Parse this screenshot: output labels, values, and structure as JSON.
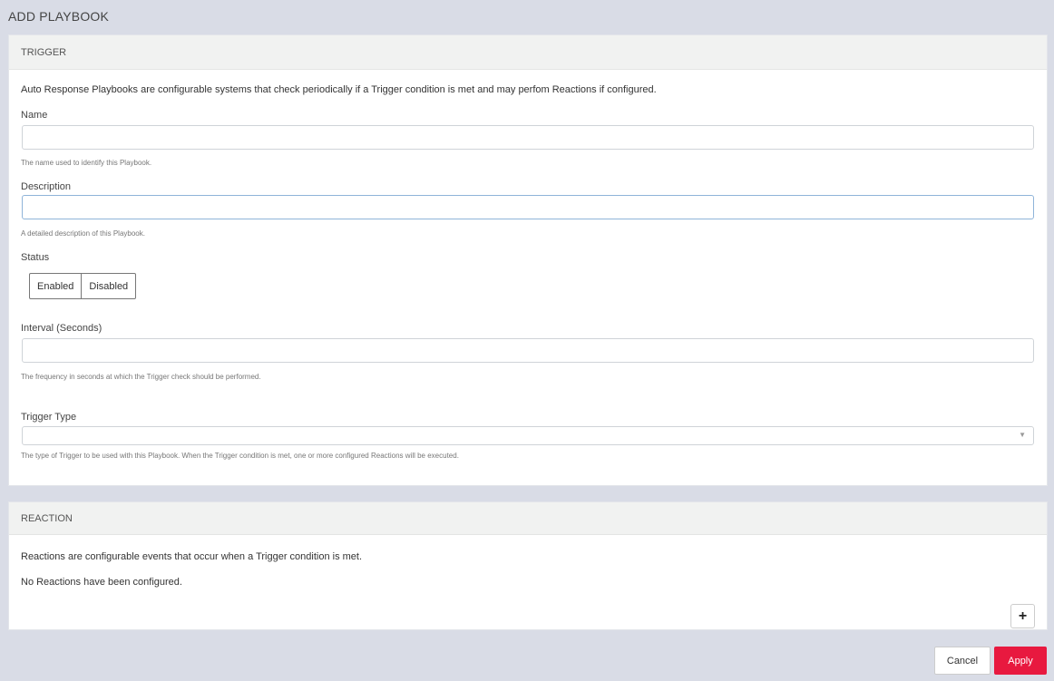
{
  "page": {
    "title": "ADD PLAYBOOK"
  },
  "trigger": {
    "header": "TRIGGER",
    "intro": "Auto Response Playbooks are configurable systems that check periodically if a Trigger condition is met and may perfom Reactions if configured.",
    "name": {
      "label": "Name",
      "value": "",
      "help": "The name used to identify this Playbook."
    },
    "description": {
      "label": "Description",
      "value": "",
      "help": "A detailed description of this Playbook."
    },
    "status": {
      "label": "Status",
      "options": [
        "Enabled",
        "Disabled"
      ]
    },
    "interval": {
      "label": "Interval (Seconds)",
      "value": "",
      "help": "The frequency in seconds at which the Trigger check should be performed."
    },
    "trigger_type": {
      "label": "Trigger Type",
      "value": "",
      "help": "The type of Trigger to be used with this Playbook. When the Trigger condition is met, one or more configured Reactions will be executed."
    }
  },
  "reaction": {
    "header": "REACTION",
    "intro": "Reactions are configurable events that occur when a Trigger condition is met.",
    "empty_text": "No Reactions have been configured.",
    "add_label": "+"
  },
  "footer": {
    "cancel_label": "Cancel",
    "apply_label": "Apply"
  },
  "colors": {
    "accent": "#e8193f",
    "background": "#d9dce6",
    "panel_header": "#f1f2f1"
  }
}
